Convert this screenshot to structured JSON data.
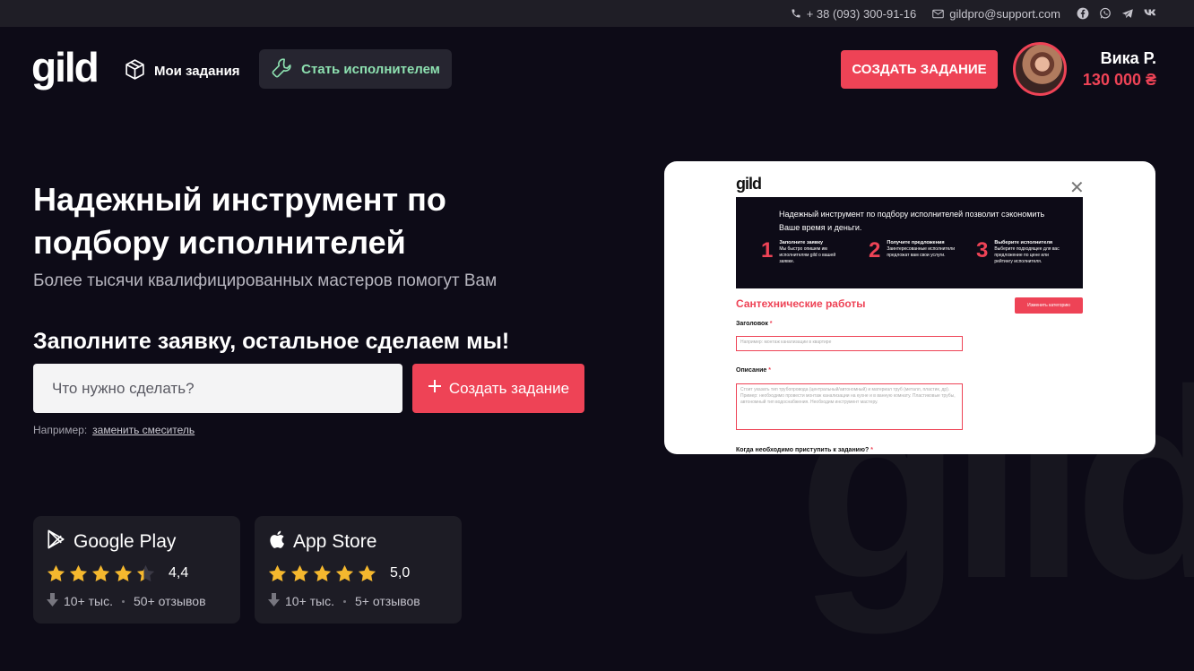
{
  "topbar": {
    "phone": "+ 38 (093) 300-91-16",
    "email": "gildpro@support.com",
    "social_icons": [
      "facebook-icon",
      "whatsapp-icon",
      "telegram-icon",
      "vk-icon"
    ]
  },
  "header": {
    "logo": "gild",
    "nav_tasks": "Мои задания",
    "nav_performer": "Стать исполнителем",
    "create_task": "СОЗДАТЬ ЗАДАНИЕ",
    "user_name": "Вика Р.",
    "user_balance": "130 000 ₴"
  },
  "hero": {
    "title": "Надежный инструмент по подбору исполнителей",
    "subtitle": "Более тысячи квалифицированных мастеров помогут Вам",
    "cta": "Заполните заявку, остальное сделаем мы!",
    "search_placeholder": "Что нужно сделать?",
    "search_button": "Создать задание",
    "example_prefix": "Например:",
    "example_link": "заменить смеситель"
  },
  "stores": [
    {
      "name": "Google Play",
      "rating": "4,4",
      "stars": 4.4,
      "downloads": "10+ тыс.",
      "reviews": "50+ отзывов"
    },
    {
      "name": "App Store",
      "rating": "5,0",
      "stars": 5.0,
      "downloads": "10+ тыс.",
      "reviews": "5+ отзывов"
    }
  ],
  "preview": {
    "logo": "gild",
    "banner_title": "Надежный инструмент по подбору исполнителей позволит сэкономить Ваше время и деньги.",
    "steps": [
      {
        "num": "1",
        "title": "Заполните заявку",
        "text": "Мы быстро опишем им исполнителям gild о вашей заявке."
      },
      {
        "num": "2",
        "title": "Получите предложения",
        "text": "Заинтересованные исполнители предложат вам свои услуги."
      },
      {
        "num": "3",
        "title": "Выберите исполнителя",
        "text": "Выберите подходящее для вас предложение по цене или рейтингу исполнителя."
      }
    ],
    "category": "Сантехнические работы",
    "change_category": "Изменить категорию",
    "label_title": "Заголовок",
    "title_placeholder": "Например: монтаж канализации в квартире",
    "label_description": "Описание",
    "description_placeholder": "Стоит указать тип трубопровода (центральный/автономный) и материал труб (металл, пластик, др). Пример: необходимо провести монтаж канализации на кухне и в ванную комнату. Пластиковые трубы, автономный тип водоснабжения. Необходим инструмент мастеру.",
    "label_when": "Когда необходимо приступить к заданию?",
    "required_mark": "*"
  },
  "colors": {
    "accent": "#ee4356",
    "background": "#0d0b17",
    "card": "#1d1c25",
    "green": "#8de0b0"
  }
}
